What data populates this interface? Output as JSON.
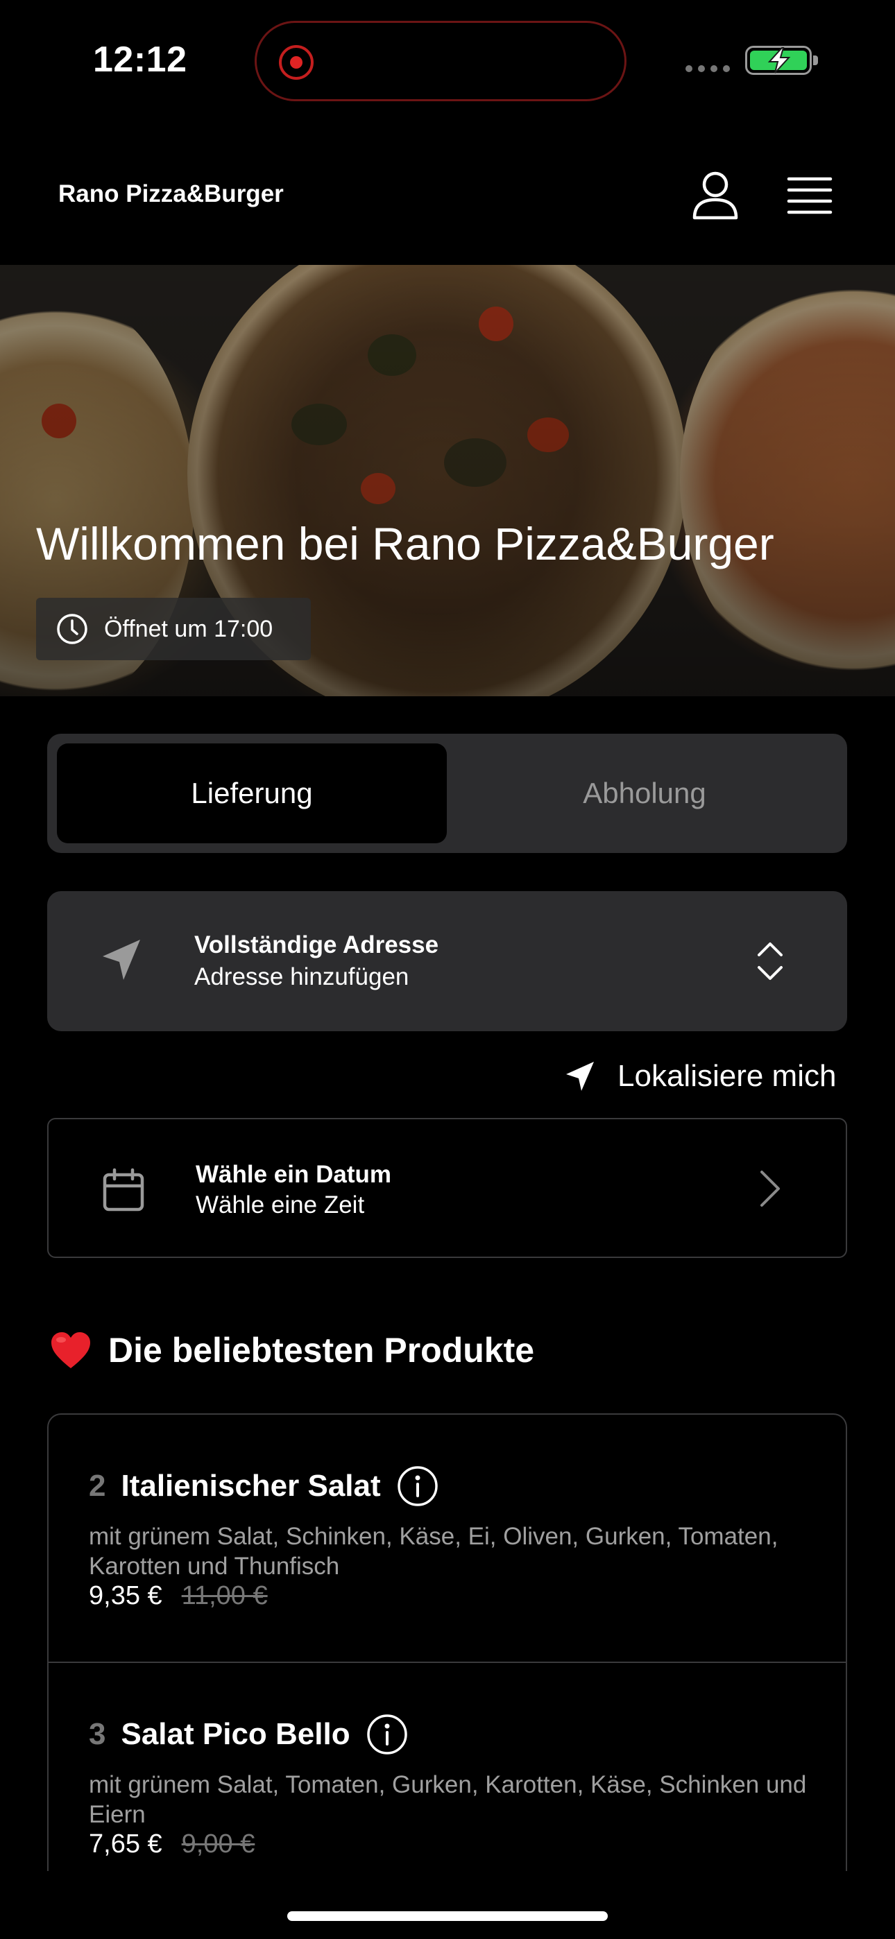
{
  "status_bar": {
    "time": "12:12"
  },
  "header": {
    "brand": "Rano Pizza&Burger"
  },
  "hero": {
    "title": "Willkommen bei Rano Pizza&Burger",
    "hours": "Öffnet um 17:00"
  },
  "segment": {
    "delivery": "Lieferung",
    "pickup": "Abholung",
    "selected": "Lieferung"
  },
  "address": {
    "title": "Vollständige Adresse",
    "subtitle": "Adresse hinzufügen"
  },
  "locate": {
    "label": "Lokalisiere mich"
  },
  "date": {
    "title": "Wähle ein Datum",
    "subtitle": "Wähle eine Zeit"
  },
  "popular": {
    "title": "Die beliebtesten Produkte",
    "items": [
      {
        "number": "2",
        "name": "Italienischer Salat",
        "description": "mit grünem Salat, Schinken, Käse, Ei, Oliven, Gurken, Tomaten, Karotten und Thunfisch",
        "price": "9,35 €",
        "old_price": "11,00 €"
      },
      {
        "number": "3",
        "name": "Salat Pico Bello",
        "description": "mit grünem Salat, Tomaten, Gurken, Karotten, Käse, Schinken und Eiern",
        "price": "7,65 €",
        "old_price": "9,00 €"
      }
    ]
  },
  "colors": {
    "background": "#000000",
    "card": "#2c2c2e",
    "battery": "#30d158",
    "heart": "#e8212b",
    "recording": "#e02424"
  }
}
